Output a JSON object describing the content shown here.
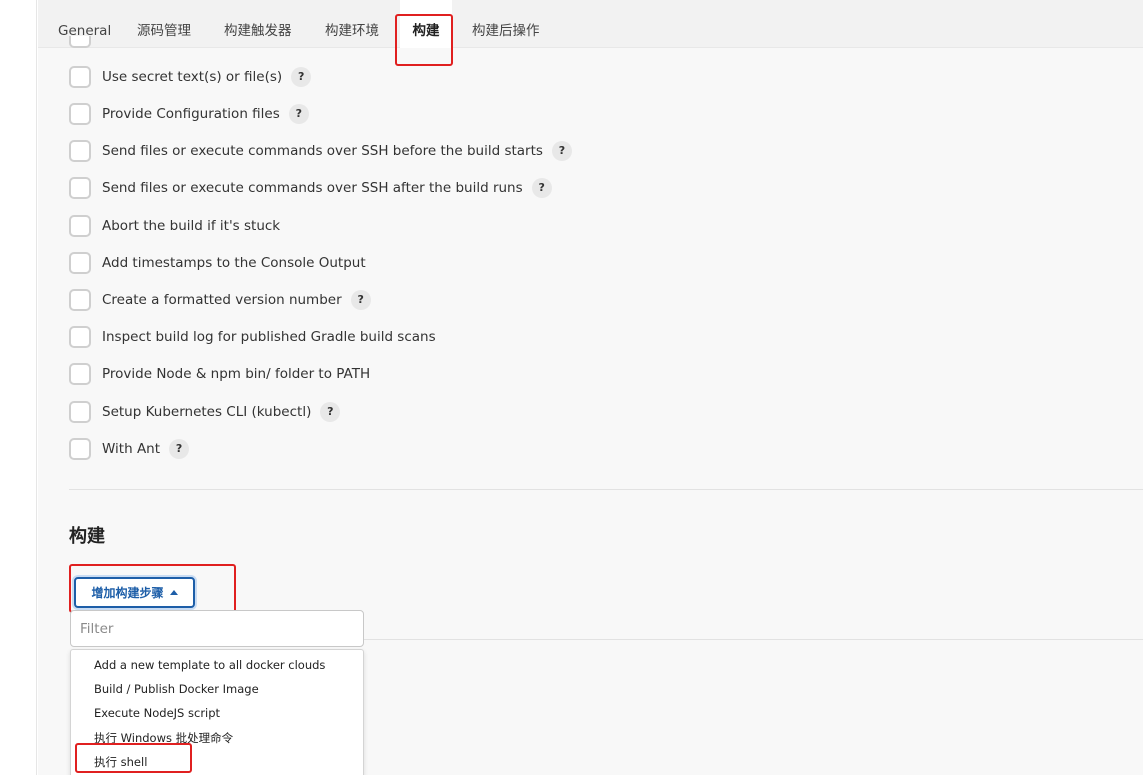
{
  "tabs": [
    {
      "label": "General"
    },
    {
      "label": "源码管理"
    },
    {
      "label": "构建触发器"
    },
    {
      "label": "构建环境"
    },
    {
      "label": "构建"
    },
    {
      "label": "构建后操作"
    }
  ],
  "options": [
    {
      "label": "Use secret text(s) or file(s)",
      "help": "?"
    },
    {
      "label": "Provide Configuration files",
      "help": "?"
    },
    {
      "label": "Send files or execute commands over SSH before the build starts",
      "help": "?"
    },
    {
      "label": "Send files or execute commands over SSH after the build runs",
      "help": "?"
    },
    {
      "label": "Abort the build if it's stuck"
    },
    {
      "label": "Add timestamps to the Console Output"
    },
    {
      "label": "Create a formatted version number",
      "help": "?"
    },
    {
      "label": "Inspect build log for published Gradle build scans"
    },
    {
      "label": "Provide Node & npm bin/ folder to PATH"
    },
    {
      "label": "Setup Kubernetes CLI (kubectl)",
      "help": "?"
    },
    {
      "label": "With Ant",
      "help": "?"
    }
  ],
  "build_section": {
    "title": "构建",
    "add_step_label": "增加构建步骤",
    "filter_placeholder": "Filter",
    "menu_items": [
      {
        "label": "Add a new template to all docker clouds"
      },
      {
        "label": "Build / Publish Docker Image"
      },
      {
        "label": "Execute NodeJS script"
      },
      {
        "label": "执行 Windows 批处理命令"
      },
      {
        "label": "执行 shell"
      }
    ]
  },
  "colors": {
    "highlight": "#e02020",
    "accent": "#1d5ea8"
  }
}
